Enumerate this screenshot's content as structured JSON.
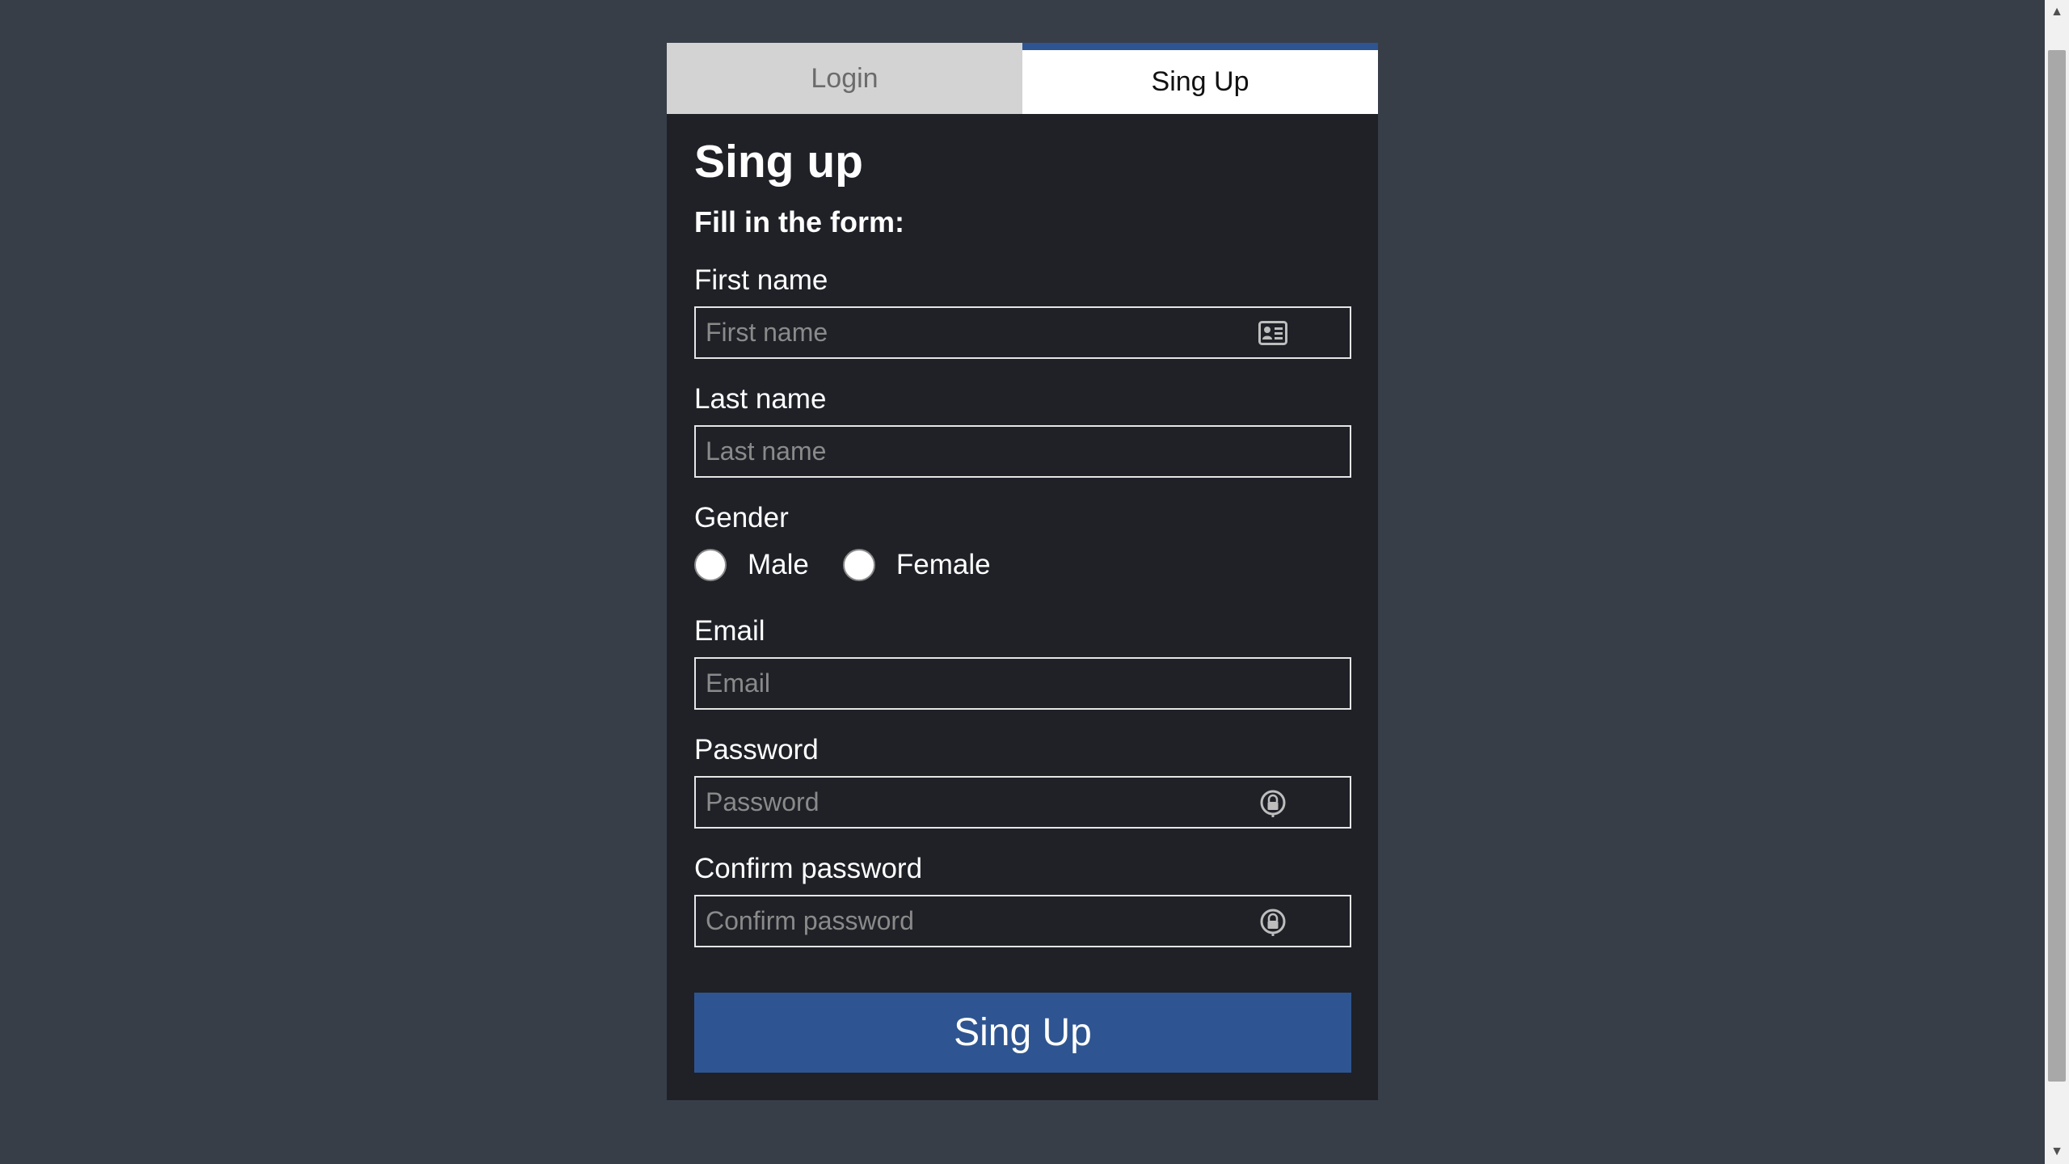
{
  "tabs": {
    "login_label": "Login",
    "signup_label": "Sing Up",
    "active": "signup"
  },
  "form": {
    "title": "Sing up",
    "subtitle": "Fill in the form:",
    "first_name": {
      "label": "First name",
      "placeholder": "First name",
      "icon": "id-card-icon"
    },
    "last_name": {
      "label": "Last name",
      "placeholder": "Last name"
    },
    "gender": {
      "label": "Gender",
      "options": [
        "Male",
        "Female"
      ]
    },
    "email": {
      "label": "Email",
      "placeholder": "Email"
    },
    "password": {
      "label": "Password",
      "placeholder": "Password",
      "icon": "lock-icon"
    },
    "confirm_password": {
      "label": "Confirm password",
      "placeholder": "Confirm password",
      "icon": "lock-icon"
    },
    "submit_label": "Sing Up"
  },
  "colors": {
    "page_background": "#373e48",
    "panel_background": "#1f2127",
    "accent": "#2e5591",
    "inactive_tab": "#d3d3d3"
  }
}
